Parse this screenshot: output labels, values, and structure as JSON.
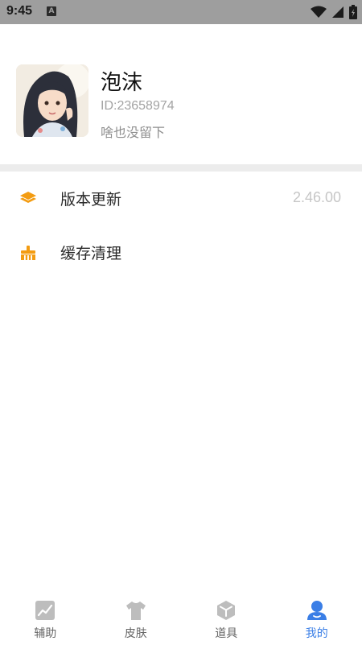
{
  "status_bar": {
    "time": "9:45",
    "notification_icon": "A",
    "icons": [
      "wifi-icon",
      "signal-icon",
      "battery-icon"
    ]
  },
  "profile": {
    "nickname": "泡沫",
    "id_text": "ID:23658974",
    "bio": "啥也没留下"
  },
  "menu": {
    "items": [
      {
        "label": "版本更新",
        "value": "2.46.00",
        "icon": "layers-icon"
      },
      {
        "label": "缓存清理",
        "value": "",
        "icon": "broom-icon"
      }
    ]
  },
  "bottom_nav": {
    "tabs": [
      {
        "label": "辅助",
        "icon": "chart-icon",
        "active": false
      },
      {
        "label": "皮肤",
        "icon": "tshirt-icon",
        "active": false
      },
      {
        "label": "道具",
        "icon": "box-icon",
        "active": false
      },
      {
        "label": "我的",
        "icon": "user-icon",
        "active": true
      }
    ]
  },
  "colors": {
    "accent": "#3a7ee6",
    "menu_icon": "#f39c12",
    "inactive_icon": "#bdbdbd",
    "status_bar": "#9e9e9e"
  }
}
